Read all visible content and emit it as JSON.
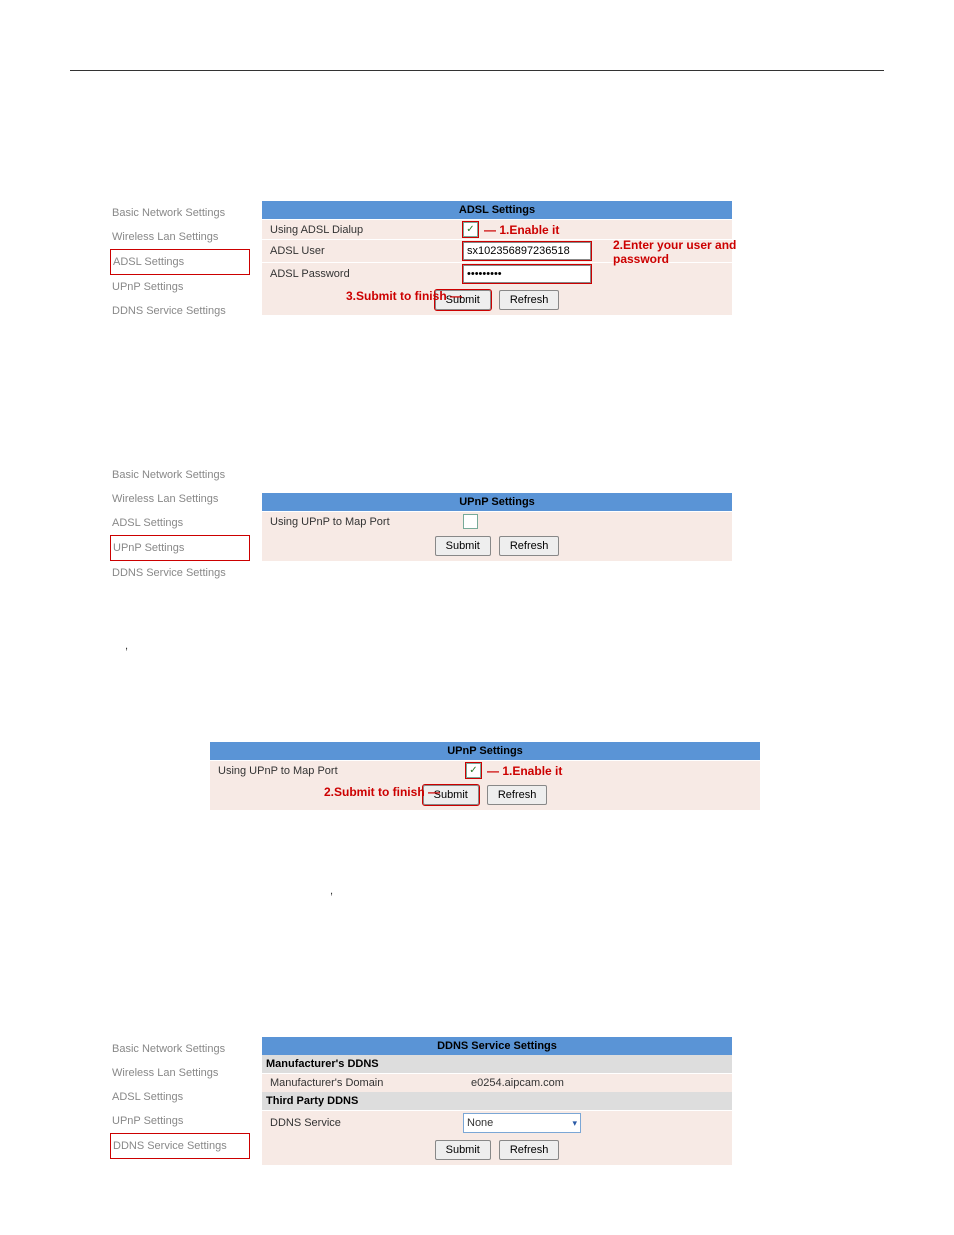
{
  "nav": {
    "basic": "Basic Network Settings",
    "wireless": "Wireless Lan Settings",
    "adsl": "ADSL Settings",
    "upnp": "UPnP Settings",
    "ddns": "DDNS Service Settings"
  },
  "adsl_panel": {
    "title": "ADSL Settings",
    "using_dialup": "Using ADSL Dialup",
    "user_label": "ADSL User",
    "user_value": "sx102356897236518",
    "password_label": "ADSL Password",
    "password_value": "•••••••••",
    "submit": "Submit",
    "refresh": "Refresh",
    "ann1": "1.Enable it",
    "ann2": "2.Enter your user and password",
    "ann3": "3.Submit to finish"
  },
  "upnp_panel": {
    "title": "UPnP Settings",
    "map_port": "Using UPnP to Map Port",
    "submit": "Submit",
    "refresh": "Refresh",
    "ann1": "1.Enable it",
    "ann2": "2.Submit to finish"
  },
  "ddns_panel": {
    "title": "DDNS Service Settings",
    "manuf_header": "Manufacturer's DDNS",
    "manuf_domain_label": "Manufacturer's Domain",
    "manuf_domain_value": "e0254.aipcam.com",
    "third_header": "Third Party DDNS",
    "ddns_service_label": "DDNS Service",
    "ddns_service_value": "None",
    "submit": "Submit",
    "refresh": "Refresh"
  },
  "misc": {
    "comma": ","
  }
}
